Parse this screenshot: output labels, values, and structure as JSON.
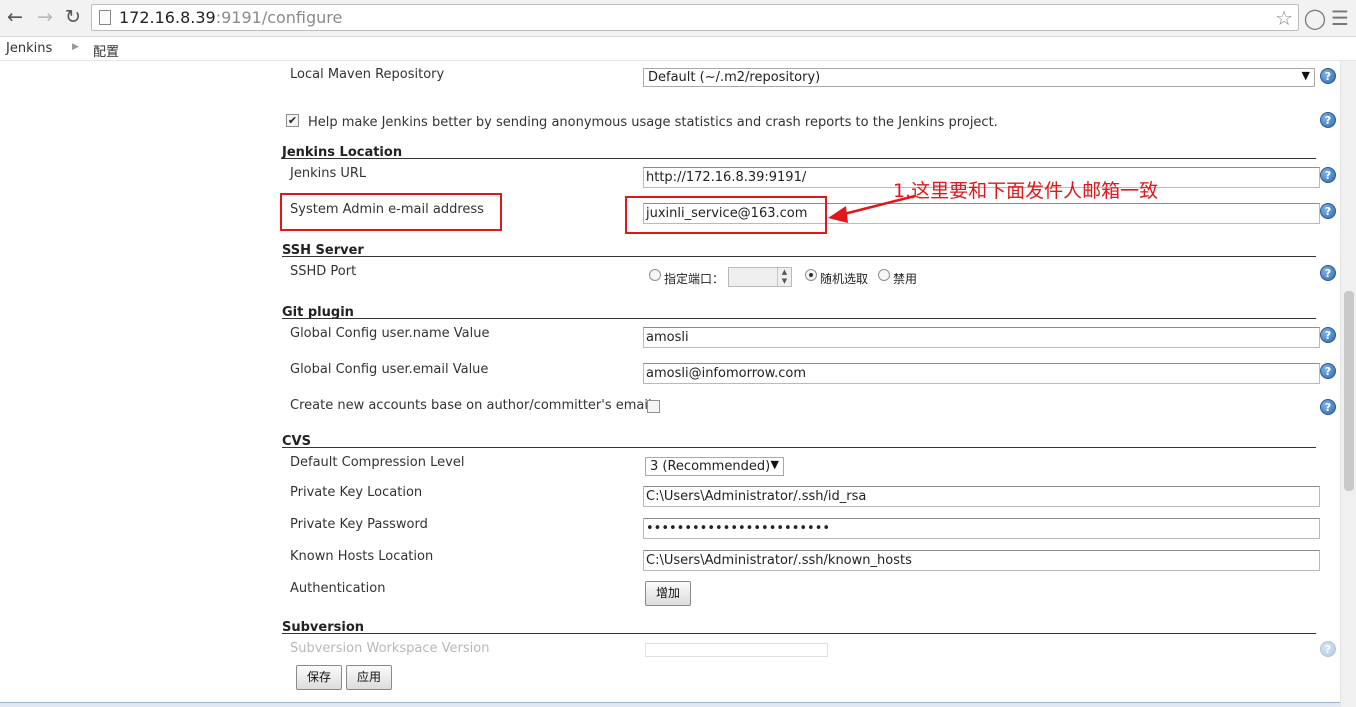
{
  "browser": {
    "url_host": "172.16.8.39",
    "url_path": ":9191/configure",
    "back_icon": "arrow-left-icon",
    "forward_icon": "arrow-right-icon",
    "reload_icon": "reload-icon",
    "star_icon": "star-icon"
  },
  "breadcrumb": {
    "root": "Jenkins",
    "current": "配置"
  },
  "maven": {
    "label": "Local Maven Repository",
    "value": "Default (~/.m2/repository)"
  },
  "usage_stats": {
    "label": "Help make Jenkins better by sending anonymous usage statistics and crash reports to the Jenkins project.",
    "checked": true
  },
  "jenkins_location": {
    "title": "Jenkins Location",
    "url_label": "Jenkins URL",
    "url_value": "http://172.16.8.39:9191/",
    "admin_email_label": "System Admin e-mail address",
    "admin_email_value": "juxinli_service@163.com"
  },
  "annotation": {
    "text": "1.这里要和下面发件人邮箱一致",
    "color": "#e0181b"
  },
  "ssh_server": {
    "title": "SSH Server",
    "port_label": "SSHD Port",
    "option_fixed": "指定端口：",
    "option_random": "随机选取",
    "option_disable": "禁用",
    "selected": "随机选取"
  },
  "git_plugin": {
    "title": "Git plugin",
    "name_label": "Global Config user.name Value",
    "name_value": "amosli",
    "email_label": "Global Config user.email Value",
    "email_value": "amosli@infomorrow.com",
    "create_accounts_label": "Create new accounts base on author/committer's email",
    "create_accounts_checked": false
  },
  "cvs": {
    "title": "CVS",
    "compression_label": "Default Compression Level",
    "compression_value": "3 (Recommended)",
    "key_location_label": "Private Key Location",
    "key_location_value": "C:\\Users\\Administrator/.ssh/id_rsa",
    "key_password_label": "Private Key Password",
    "key_password_value": "••••••••••••••••••••••••",
    "known_hosts_label": "Known Hosts Location",
    "known_hosts_value": "C:\\Users\\Administrator/.ssh/known_hosts",
    "auth_label": "Authentication",
    "add_button": "增加"
  },
  "subversion": {
    "title": "Subversion",
    "workspace_label": "Subversion Workspace Version"
  },
  "footer": {
    "save_button": "保存",
    "apply_button": "应用"
  }
}
